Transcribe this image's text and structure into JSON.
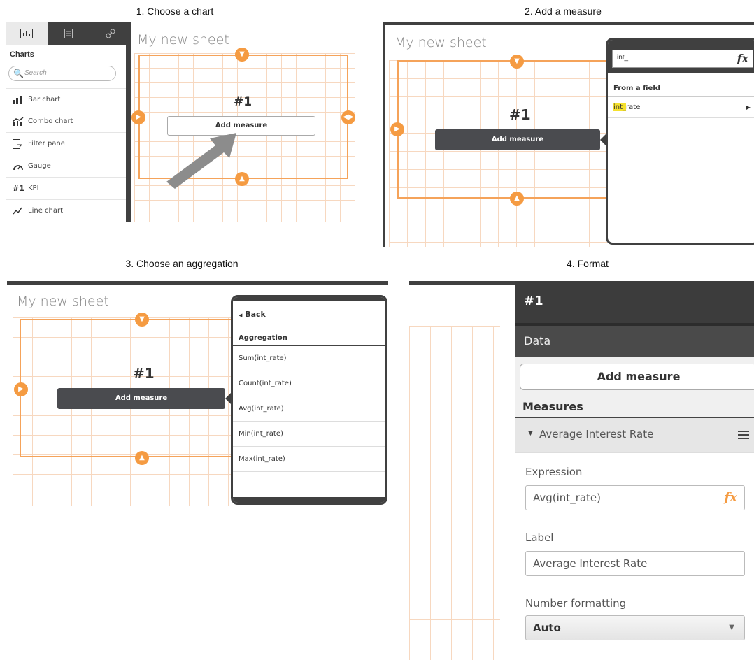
{
  "captions": {
    "step1": "1. Choose a chart",
    "step2": "2. Add a measure",
    "step3": "3. Choose an aggregation",
    "step4": "4. Format"
  },
  "sheet_title": "My new sheet",
  "kpi_placeholder": "#1",
  "add_measure_label": "Add measure",
  "step1": {
    "sidebar_heading": "Charts",
    "search_placeholder": "Search",
    "chart_types": [
      {
        "label": "Bar chart",
        "icon": "bar-chart-icon"
      },
      {
        "label": "Combo chart",
        "icon": "combo-chart-icon"
      },
      {
        "label": "Filter pane",
        "icon": "filter-pane-icon"
      },
      {
        "label": "Gauge",
        "icon": "gauge-icon"
      },
      {
        "label": "KPI",
        "icon": "kpi-icon",
        "glyph": "#1"
      },
      {
        "label": "Line chart",
        "icon": "line-chart-icon"
      }
    ]
  },
  "step2": {
    "search_value": "int_",
    "fx_label": "fx",
    "section_heading": "From a field",
    "field_highlight": "int_",
    "field_rest": "rate"
  },
  "step3": {
    "back_label": "Back",
    "section_heading": "Aggregation",
    "options": [
      "Sum(int_rate)",
      "Count(int_rate)",
      "Avg(int_rate)",
      "Min(int_rate)",
      "Max(int_rate)"
    ]
  },
  "step4": {
    "header_title": "#1",
    "data_tab": "Data",
    "add_measure": "Add measure",
    "measures_heading": "Measures",
    "measure_name": "Average Interest Rate",
    "expression_label": "Expression",
    "expression_value": "Avg(int_rate)",
    "fx_label": "fx",
    "label_label": "Label",
    "label_value": "Average Interest Rate",
    "number_formatting_label": "Number formatting",
    "number_formatting_value": "Auto"
  },
  "colors": {
    "accent_orange": "#f59b42",
    "dark_bar": "#404040",
    "highlight_yellow": "#f5e12e"
  }
}
